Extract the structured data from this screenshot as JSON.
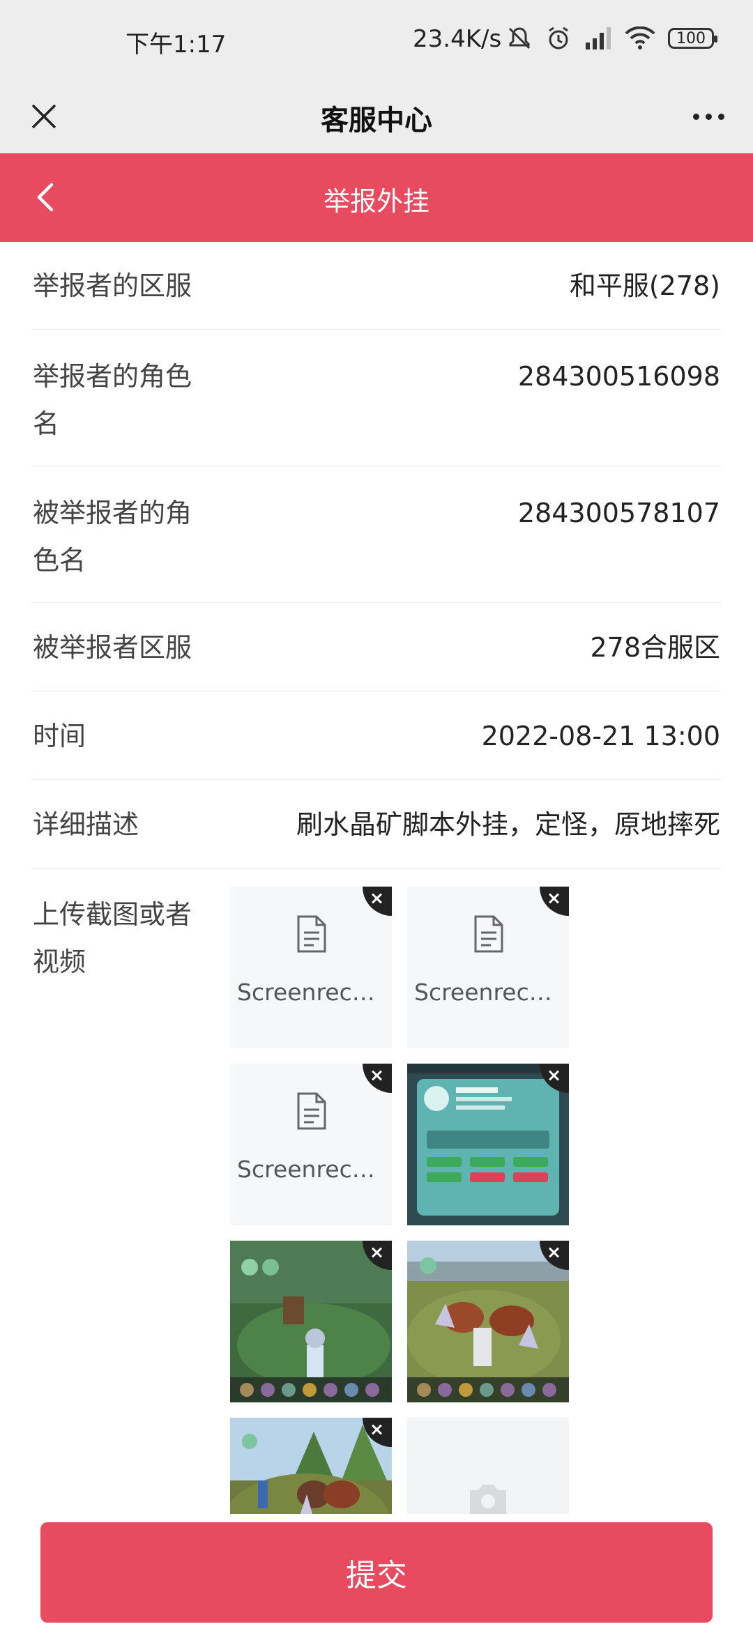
{
  "status": {
    "time": "下午1:17",
    "speed": "23.4K/s",
    "battery": "100"
  },
  "titlebar": {
    "title": "客服中心"
  },
  "header": {
    "title": "举报外挂"
  },
  "form": {
    "rows": [
      {
        "label": "举报者的区服",
        "value": "和平服(278)"
      },
      {
        "label": "举报者的角色名",
        "value": "284300516098"
      },
      {
        "label": "被举报者的角色名",
        "value": "284300578107"
      },
      {
        "label": "被举报者区服",
        "value": "278合服区"
      },
      {
        "label": "时间",
        "value": "2022-08-21 13:00"
      },
      {
        "label": "详细描述",
        "value": "刷水晶矿脚本外挂，定怪，原地摔死"
      }
    ],
    "upload_label": "上传截图或者视频"
  },
  "uploads": {
    "files": [
      {
        "name": "Screenreco..."
      },
      {
        "name": "Screenreco..."
      },
      {
        "name": "Screenreco..."
      }
    ]
  },
  "submit_label": "提交",
  "colors": {
    "accent": "#e84a5f",
    "bar": "#ededed"
  }
}
